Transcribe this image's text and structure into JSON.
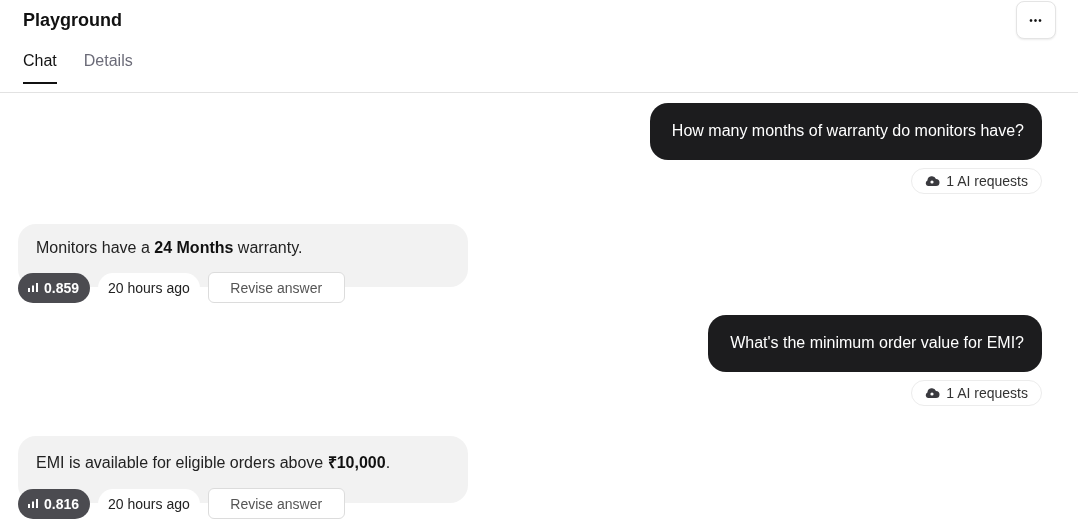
{
  "header": {
    "title": "Playground",
    "menu_button": "•••"
  },
  "tabs": [
    {
      "label": "Chat",
      "selected": true
    },
    {
      "label": "Details",
      "selected": false
    }
  ],
  "messages": [
    {
      "kind": "user",
      "text": "How many months of warranty do monitors have?",
      "requests": "1 AI requests"
    },
    {
      "kind": "assistant",
      "text": "Monitors have a **24 Months** warranty.",
      "score": "0.859",
      "time": "20 hours ago",
      "action": "Revise answer"
    },
    {
      "kind": "user",
      "text": "What's the minimum order value for EMI?",
      "requests": "1 AI requests"
    },
    {
      "kind": "assistant",
      "text": "EMI is available for eligible orders above **₹10,000**.",
      "score": "0.816",
      "time": "20 hours ago",
      "action": "Revise answer"
    }
  ]
}
